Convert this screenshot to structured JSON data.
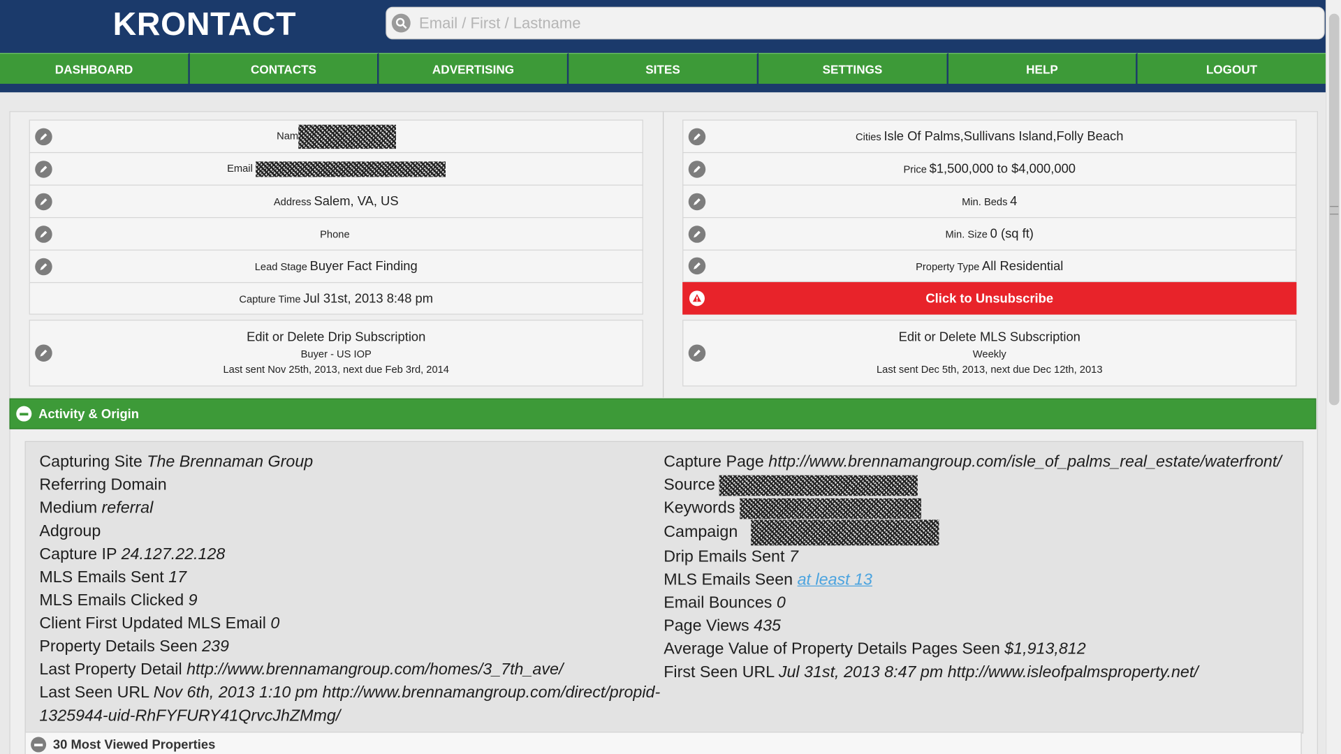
{
  "header": {
    "logo": "KRONTACT",
    "search_placeholder": "Email / First / Lastname"
  },
  "nav": [
    "DASHBOARD",
    "CONTACTS",
    "ADVERTISING",
    "SITES",
    "SETTINGS",
    "HELP",
    "LOGOUT"
  ],
  "contact": {
    "name_label": "Name",
    "email_label": "Email",
    "address_label": "Address",
    "address_value": "Salem, VA, US",
    "phone_label": "Phone",
    "lead_stage_label": "Lead Stage",
    "lead_stage_value": "Buyer Fact Finding",
    "capture_time_label": "Capture Time",
    "capture_time_value": "Jul 31st, 2013 8:48 pm",
    "drip": {
      "title": "Edit or Delete Drip Subscription",
      "plan": "Buyer - US IOP",
      "schedule": "Last sent Nov 25th, 2013, next due Feb 3rd, 2014"
    }
  },
  "search_prefs": {
    "cities_label": "Cities",
    "cities_value": "Isle Of Palms,Sullivans Island,Folly Beach",
    "price_label": "Price",
    "price_value": "$1,500,000 to $4,000,000",
    "beds_label": "Min. Beds",
    "beds_value": "4",
    "size_label": "Min. Size",
    "size_value": "0 (sq ft)",
    "type_label": "Property Type",
    "type_value": "All Residential",
    "unsubscribe": "Click to Unsubscribe",
    "mls": {
      "title": "Edit or Delete MLS Subscription",
      "frequency": "Weekly",
      "schedule": "Last sent Dec 5th, 2013, next due Dec 12th, 2013"
    }
  },
  "activity": {
    "title": "Activity & Origin",
    "left": [
      {
        "label": "Capturing Site",
        "value": "The Brennaman Group"
      },
      {
        "label": "Referring Domain",
        "value": ""
      },
      {
        "label": "Medium",
        "value": "referral"
      },
      {
        "label": "Adgroup",
        "value": ""
      },
      {
        "label": "Capture IP",
        "value": "24.127.22.128"
      },
      {
        "label": "MLS Emails Sent",
        "value": "17"
      },
      {
        "label": "MLS Emails Clicked",
        "value": "9"
      },
      {
        "label": "Client First Updated MLS Email",
        "value": "0"
      },
      {
        "label": "Property Details Seen",
        "value": "239"
      },
      {
        "label": "Last Property Detail",
        "value": "http://www.brennamangroup.com/homes/3_7th_ave/"
      },
      {
        "label": "Last Seen URL",
        "value": "Nov 6th, 2013 1:10 pm http://www.brennamangroup.com/direct/propid-"
      },
      {
        "label": "",
        "value": "1325944-uid-RhFYFURY41QrvcJhZMmg/"
      }
    ],
    "right": [
      {
        "label": "Capture Page",
        "value": "http://www.brennamangroup.com/isle_of_palms_real_estate/waterfront/"
      },
      {
        "label": "Source",
        "value": ""
      },
      {
        "label": "Keywords",
        "value": ""
      },
      {
        "label": "Campaign",
        "value": ""
      },
      {
        "label": "Drip Emails Sent",
        "value": "7"
      },
      {
        "label": "MLS Emails Seen",
        "value": "at least 13"
      },
      {
        "label": "Email Bounces",
        "value": "0"
      },
      {
        "label": "Page Views",
        "value": "435"
      },
      {
        "label": "Average Value of Property Details Pages Seen",
        "value": "$1,913,812"
      },
      {
        "label": "First Seen URL",
        "value": "Jul 31st, 2013 8:47 pm http://www.isleofpalmsproperty.net/"
      }
    ]
  },
  "most_viewed": {
    "title": "30 Most Viewed Properties"
  },
  "colors": {
    "header_bg": "#1b3a6b",
    "nav_green": "#3d9a38",
    "unsubscribe_red": "#e8232a",
    "link_blue": "#4aa3df"
  }
}
